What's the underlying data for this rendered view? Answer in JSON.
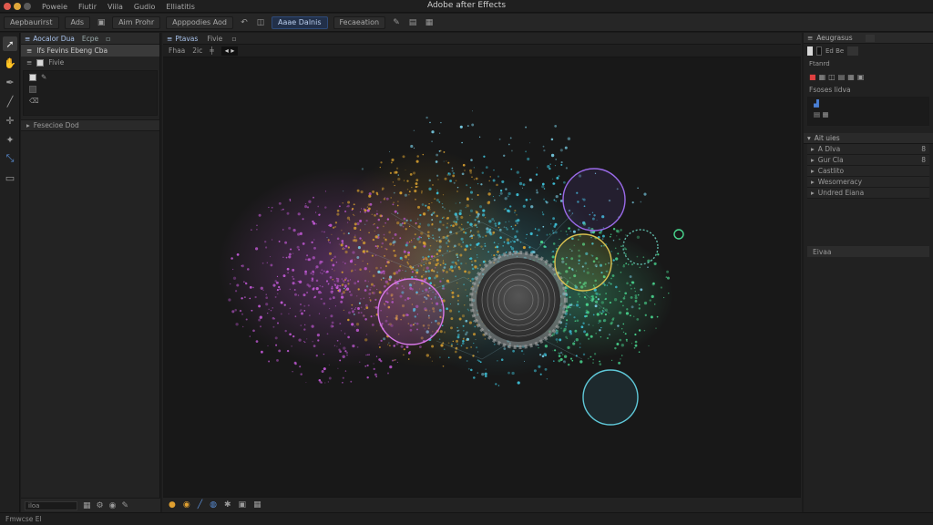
{
  "window": {
    "title": "Adobe after Effects",
    "menu": [
      "Poweie",
      "Fiutir",
      "Viila",
      "Gudio",
      "Elliatitis"
    ]
  },
  "toolbar": {
    "buttons": [
      {
        "label": "Aepbaurirst"
      },
      {
        "label": "Ads"
      },
      {
        "label": "Aim Prohr"
      },
      {
        "label": "Apppodies Aod"
      },
      {
        "label": "Aaae Dalnis"
      },
      {
        "label": "Fecaeation"
      }
    ]
  },
  "left_panel": {
    "tabs": [
      "Aocalor Dua",
      "Ecpe"
    ],
    "row1": "Ifs Fevins Ebeng Cba",
    "row2": "Fivie",
    "section": "Fesecioe Dod",
    "search_placeholder": "iloa"
  },
  "center": {
    "tabs": [
      "Ptavas",
      "Fivie"
    ],
    "sub": [
      "Fhaa",
      "2ic"
    ]
  },
  "right_panel": {
    "header": "Aeugrasus",
    "label1": "Ftanrd",
    "label2": "Fsoses lidva",
    "layers_header": "Ait uies",
    "effects": [
      {
        "label": "A Dlva",
        "mark": "8"
      },
      {
        "label": "Gur Cla",
        "mark": "8"
      },
      {
        "label": "Castlito",
        "mark": ""
      },
      {
        "label": "Wesomeracy",
        "mark": ""
      },
      {
        "label": "Undred Eiana",
        "mark": ""
      }
    ],
    "bottom_bar": "Eivaa"
  },
  "statusbar": {
    "text": "Fmwcse El"
  },
  "colors": {
    "accent": "#4a7fd4",
    "bg": "#181818",
    "purple": "#c45ad8",
    "gold": "#d8a030",
    "cyan": "#3fc8e0",
    "green": "#4ad890",
    "violet": "#9a6ae8"
  }
}
